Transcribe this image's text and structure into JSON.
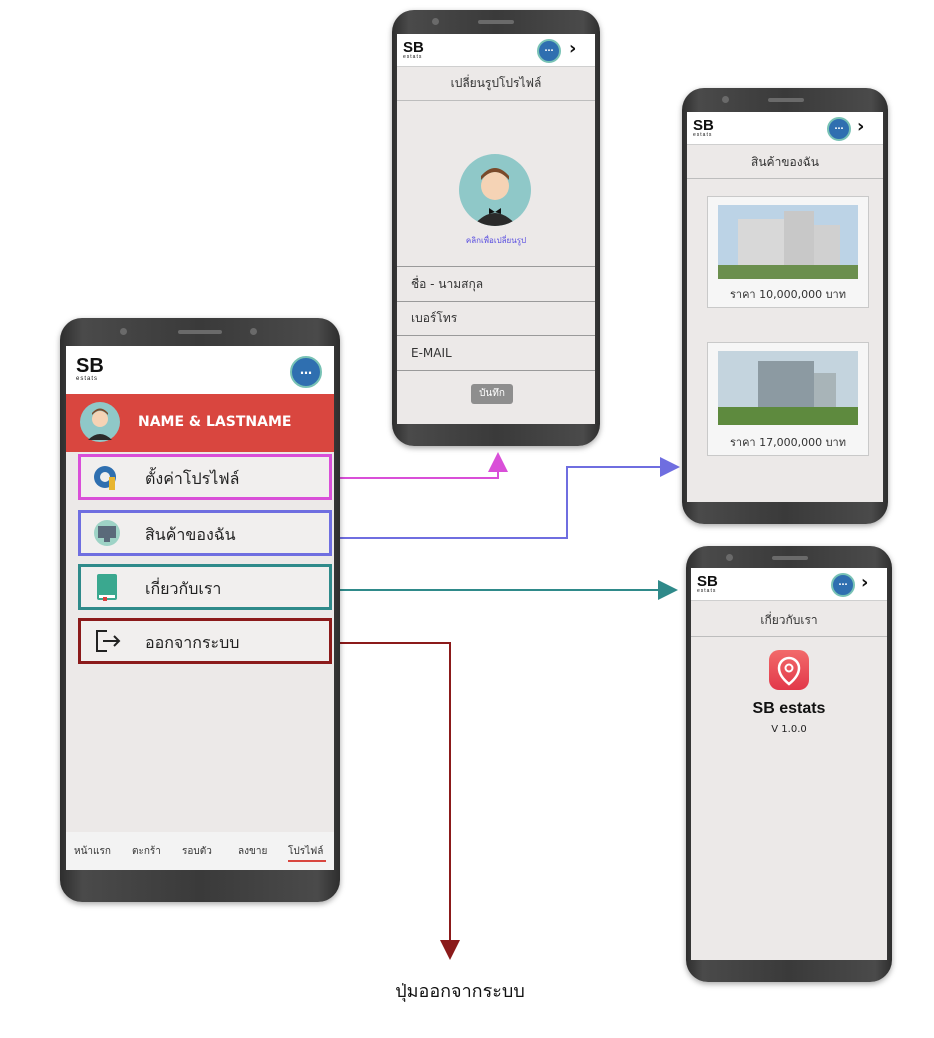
{
  "brand": {
    "logo": "SB",
    "logo_sub": "estats",
    "chat_icon": "chat-bubble-icon",
    "back_icon": "chevron-right-icon"
  },
  "main_phone": {
    "user_name": "NAME & LASTNAME",
    "menu": [
      {
        "label": "ตั้งค่าโปรไฟล์",
        "icon": "gear-icon",
        "color": "#d94fd8"
      },
      {
        "label": "สินค้าของฉัน",
        "icon": "monitor-icon",
        "color": "#6f6ee0"
      },
      {
        "label": "เกี่ยวกับเรา",
        "icon": "book-icon",
        "color": "#2f8a8a"
      },
      {
        "label": "ออกจากระบบ",
        "icon": "logout-icon",
        "color": "#8b1a1a"
      }
    ],
    "bottom_nav": [
      "หน้าแรก",
      "ตะกร้า",
      "รอบตัว",
      "ลงขาย",
      "โปรไฟล์"
    ],
    "active_nav": "โปรไฟล์"
  },
  "profile_phone": {
    "title": "เปลี่ยนรูปโปรไฟล์",
    "change_photo_link": "คลิกเพื่อเปลี่ยนรูป",
    "fields": [
      "ชื่อ - นามสกุล",
      "เบอร์โทร",
      "E-MAIL"
    ],
    "save_button": "บันทึก"
  },
  "products_phone": {
    "title": "สินค้าของฉัน",
    "products": [
      {
        "price": "ราคา 10,000,000 บาท"
      },
      {
        "price": "ราคา 17,000,000 บาท"
      }
    ]
  },
  "about_phone": {
    "title": "เกี่ยวกับเรา",
    "app_name": "SB estats",
    "version": "V 1.0.0"
  },
  "caption": "ปุ่มออกจากระบบ",
  "colors": {
    "header_red": "#d9463f",
    "pink": "#d94fd8",
    "purple": "#6f6ee0",
    "teal": "#2f8a8a",
    "maroon": "#8b1a1a"
  }
}
